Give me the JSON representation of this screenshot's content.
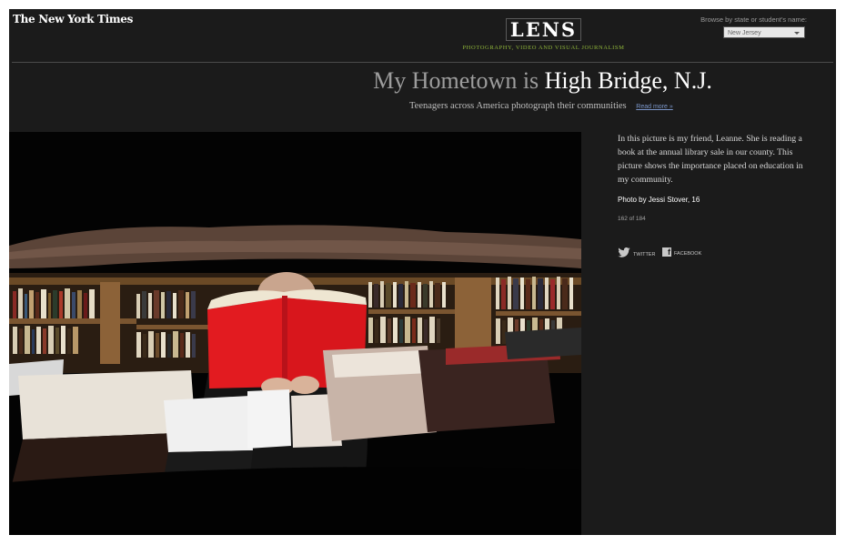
{
  "header": {
    "nyt_logo": "The New York Times",
    "lens_logo": "LENS",
    "lens_tagline": "Photography, Video and Visual Journalism",
    "browse_label": "Browse by state or student's name:",
    "state_select_value": "New Jersey"
  },
  "title": {
    "prefix": "My Hometown is ",
    "place": "High Bridge, N.J."
  },
  "subtitle": {
    "text": "Teenagers across America photograph their communities",
    "read_more": "Read more »"
  },
  "photo": {
    "description": "Girl behind a red book at a library book sale"
  },
  "sidebar": {
    "caption": "In this picture is my friend, Leanne. She is reading a book at the annual library sale in our county. This picture shows the importance placed on education in my community.",
    "credit": "Photo by Jessi Stover, 16",
    "counter": "162 of 184",
    "share": {
      "twitter": "TWITTER",
      "facebook": "FACEBOOK"
    }
  },
  "colors": {
    "background": "#1b1b1b",
    "lens_tagline": "#8fb53a",
    "read_more_link": "#7b96c9",
    "book_red": "#e21b20"
  }
}
